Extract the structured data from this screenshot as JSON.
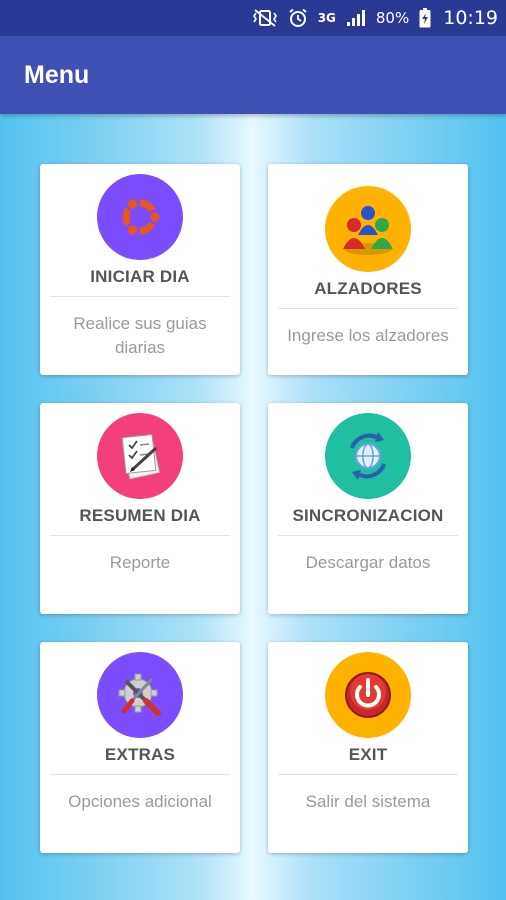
{
  "status_bar": {
    "network": "3G",
    "battery": "80%",
    "time": "10:19"
  },
  "app_bar": {
    "title": "Menu"
  },
  "colors": {
    "status_bar": "#2a3993",
    "app_bar": "#3f51b5",
    "purple": "#7c4dff",
    "amber": "#ffb300",
    "pink": "#f4407a",
    "teal": "#1fbfa0"
  },
  "cards": [
    {
      "title": "INICIAR DIA",
      "subtitle": "Realice sus guias diarias",
      "icon": "ubuntu-logo-icon",
      "circle_color": "#7c4dff"
    },
    {
      "title": "ALZADORES",
      "subtitle": "Ingrese los alzadores",
      "icon": "people-group-icon",
      "circle_color": "#ffb300"
    },
    {
      "title": "RESUMEN DIA",
      "subtitle": "Reporte",
      "icon": "checklist-paper-icon",
      "circle_color": "#f4407a"
    },
    {
      "title": "SINCRONIZACION",
      "subtitle": "Descargar datos",
      "icon": "globe-sync-icon",
      "circle_color": "#1fbfa0"
    },
    {
      "title": "EXTRAS",
      "subtitle": "Opciones adicional",
      "icon": "gear-tools-icon",
      "circle_color": "#7c4dff"
    },
    {
      "title": "EXIT",
      "subtitle": "Salir del sistema",
      "icon": "power-icon",
      "circle_color": "#ffb300"
    }
  ]
}
